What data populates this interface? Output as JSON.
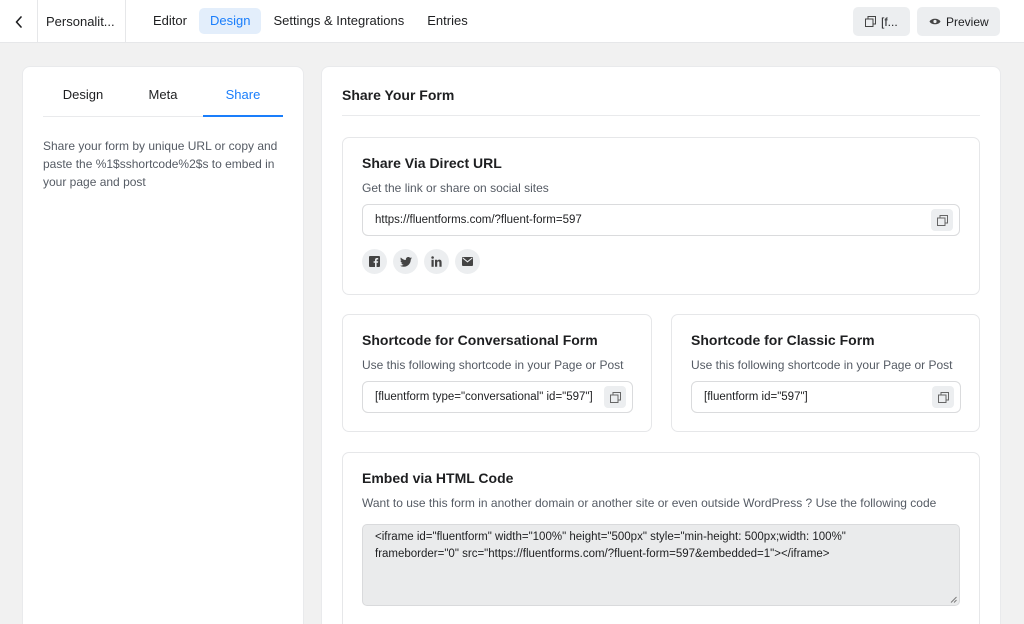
{
  "topbar": {
    "form_title": "Personalit...",
    "nav": [
      "Editor",
      "Design",
      "Settings & Integrations",
      "Entries"
    ],
    "active_nav": "Design",
    "shortcode_btn_label": "[f...",
    "preview_label": "Preview"
  },
  "left": {
    "tabs": [
      "Design",
      "Meta",
      "Share"
    ],
    "active_tab": "Share",
    "description": "Share your form by unique URL or copy and paste the %1$sshortcode%2$s to embed in your page and post"
  },
  "right": {
    "title": "Share Your Form",
    "direct_url": {
      "title": "Share Via Direct URL",
      "subtitle": "Get the link or share on social sites",
      "url": "https://fluentforms.com/?fluent-form=597",
      "socials": [
        "facebook-icon",
        "twitter-icon",
        "linkedin-icon",
        "email-icon"
      ]
    },
    "conversational": {
      "title": "Shortcode for Conversational Form",
      "subtitle": "Use this following shortcode in your Page or Post",
      "code": "[fluentform type=\"conversational\" id=\"597\"]"
    },
    "classic": {
      "title": "Shortcode for Classic Form",
      "subtitle": "Use this following shortcode in your Page or Post",
      "code": "[fluentform id=\"597\"]"
    },
    "embed": {
      "title": "Embed via HTML Code",
      "subtitle": "Want to use this form in another domain or another site or even outside WordPress ? Use the following code",
      "code_line1": "<iframe id=\"fluentform\" width=\"100%\" height=\"500px\" style=\"min-height: 500px;width: 100%\"",
      "code_line2": "frameborder=\"0\" src=\"https://fluentforms.com/?fluent-form=597&embedded=1\"></iframe>"
    }
  },
  "colors": {
    "accent": "#1a7efb",
    "active_bg": "#e3eefb",
    "page_bg": "#f1f1f1"
  }
}
